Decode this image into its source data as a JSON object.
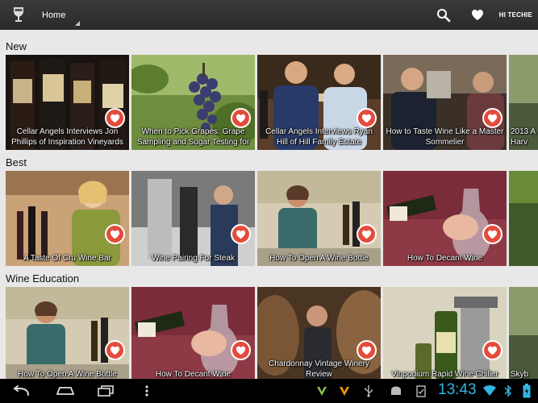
{
  "actionbar": {
    "nav_label": "Home",
    "user_label": "HI TECHIE"
  },
  "sections": [
    {
      "title": "New",
      "tiles": [
        {
          "caption": "Cellar Angels Interviews Jon Phillips of Inspiration Vineyards",
          "scene": "bottles"
        },
        {
          "caption": "When to Pick Grapes: Grape Sampling and Sugar Testing for",
          "scene": "grapes"
        },
        {
          "caption": "Cellar Angels Interviews Ryan Hill of Hill Family Estate",
          "scene": "interview"
        },
        {
          "caption": "How to Taste Wine Like a Master Sommelier",
          "scene": "tasting"
        },
        {
          "caption": "2013 A Harv",
          "scene": "partial"
        }
      ]
    },
    {
      "title": "Best",
      "tiles": [
        {
          "caption": "A Taste Of Cru Wine Bar",
          "scene": "winebar"
        },
        {
          "caption": "Wine Pairing For Steak",
          "scene": "pairing"
        },
        {
          "caption": "How To Open A Wine Bottle",
          "scene": "opening"
        },
        {
          "caption": "How To Decant Wine",
          "scene": "decant"
        },
        {
          "caption": "",
          "scene": "vineyard"
        }
      ]
    },
    {
      "title": "Wine Education",
      "tiles": [
        {
          "caption": "How To Open A Wine Bottle",
          "scene": "opening"
        },
        {
          "caption": "How To Decant Wine",
          "scene": "decant"
        },
        {
          "caption": "Chardonnay Vintage Winery Review",
          "scene": "barrels"
        },
        {
          "caption": "Vinpodium Rapid Wine Chiller",
          "scene": "chiller"
        },
        {
          "caption": "Skyb",
          "scene": "partial"
        }
      ]
    }
  ],
  "statusbar": {
    "time": "13:43"
  },
  "colors": {
    "actionbar": "#2f2f2f",
    "favorite": "#e44b3b",
    "clock": "#33b5e5"
  }
}
